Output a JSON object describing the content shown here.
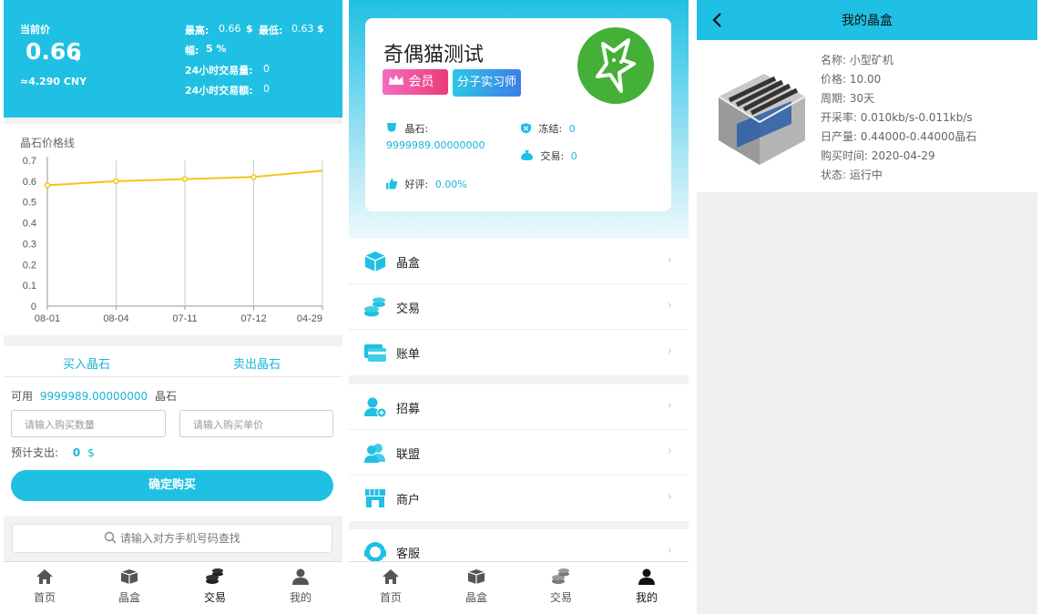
{
  "market": {
    "current_label": "当前价",
    "price": "0.66",
    "price_unit": "$",
    "cny": "≈4.290 CNY",
    "high_label": "最高:",
    "high_value": "0.66",
    "high_unit": "$",
    "low_label": "最低:",
    "low_value": "0.63",
    "low_unit": "$",
    "range_label": "幅:",
    "range_value": "5 %",
    "vol24_label": "24小时交易量:",
    "vol24_value": "0",
    "amt24_label": "24小时交易额:",
    "amt24_value": "0"
  },
  "chart_data": {
    "type": "line",
    "title": "晶石价格线",
    "categories": [
      "08-01",
      "08-04",
      "07-11",
      "07-12",
      "04-29"
    ],
    "series": [
      {
        "values": [
          0.58,
          0.6,
          0.61,
          0.62,
          0.65
        ]
      }
    ],
    "ylim": [
      0,
      0.7
    ],
    "yticks": [
      "0",
      "0.1",
      "0.2",
      "0.3",
      "0.4",
      "0.5",
      "0.6",
      "0.7"
    ],
    "color": "#f5c518",
    "grid": true
  },
  "trade": {
    "tab_buy": "买入晶石",
    "tab_sell": "卖出晶石",
    "available_label": "可用",
    "available_value": "9999989.00000000",
    "available_unit": "晶石",
    "qty_placeholder": "请输入购买数量",
    "price_placeholder": "请输入购买单价",
    "est_label": "预计支出:",
    "est_value": "0",
    "est_unit": "$",
    "confirm": "确定购买",
    "search_placeholder": "请输入对方手机号码查找"
  },
  "tabbar": {
    "home": "首页",
    "box": "晶盒",
    "trade": "交易",
    "mine": "我的"
  },
  "profile": {
    "name": "奇偶猫测试",
    "badge_member": "会员",
    "badge_level": "分子实习师",
    "crystal_label": "晶石:",
    "crystal_value": "9999989.00000000",
    "frozen_label": "冻结:",
    "frozen_value": "0",
    "trade_label": "交易:",
    "trade_value": "0",
    "rating_label": "好评:",
    "rating_value": "0.00%"
  },
  "menu": {
    "group1": [
      "晶盒",
      "交易",
      "账单"
    ],
    "group2": [
      "招募",
      "联盟",
      "商户"
    ],
    "group3": [
      "客服"
    ]
  },
  "mybox": {
    "title": "我的晶盒",
    "name_line": "名称:  小型矿机",
    "price_line": "价格:  10.00",
    "cycle_line": "周期:  30天",
    "rate_line": "开采率:  0.010kb/s-0.011kb/s",
    "daily_line": "日产量:  0.44000-0.44000晶石",
    "date_line": "购买时间:   2020-04-29",
    "status_line": "状态:  运行中"
  }
}
